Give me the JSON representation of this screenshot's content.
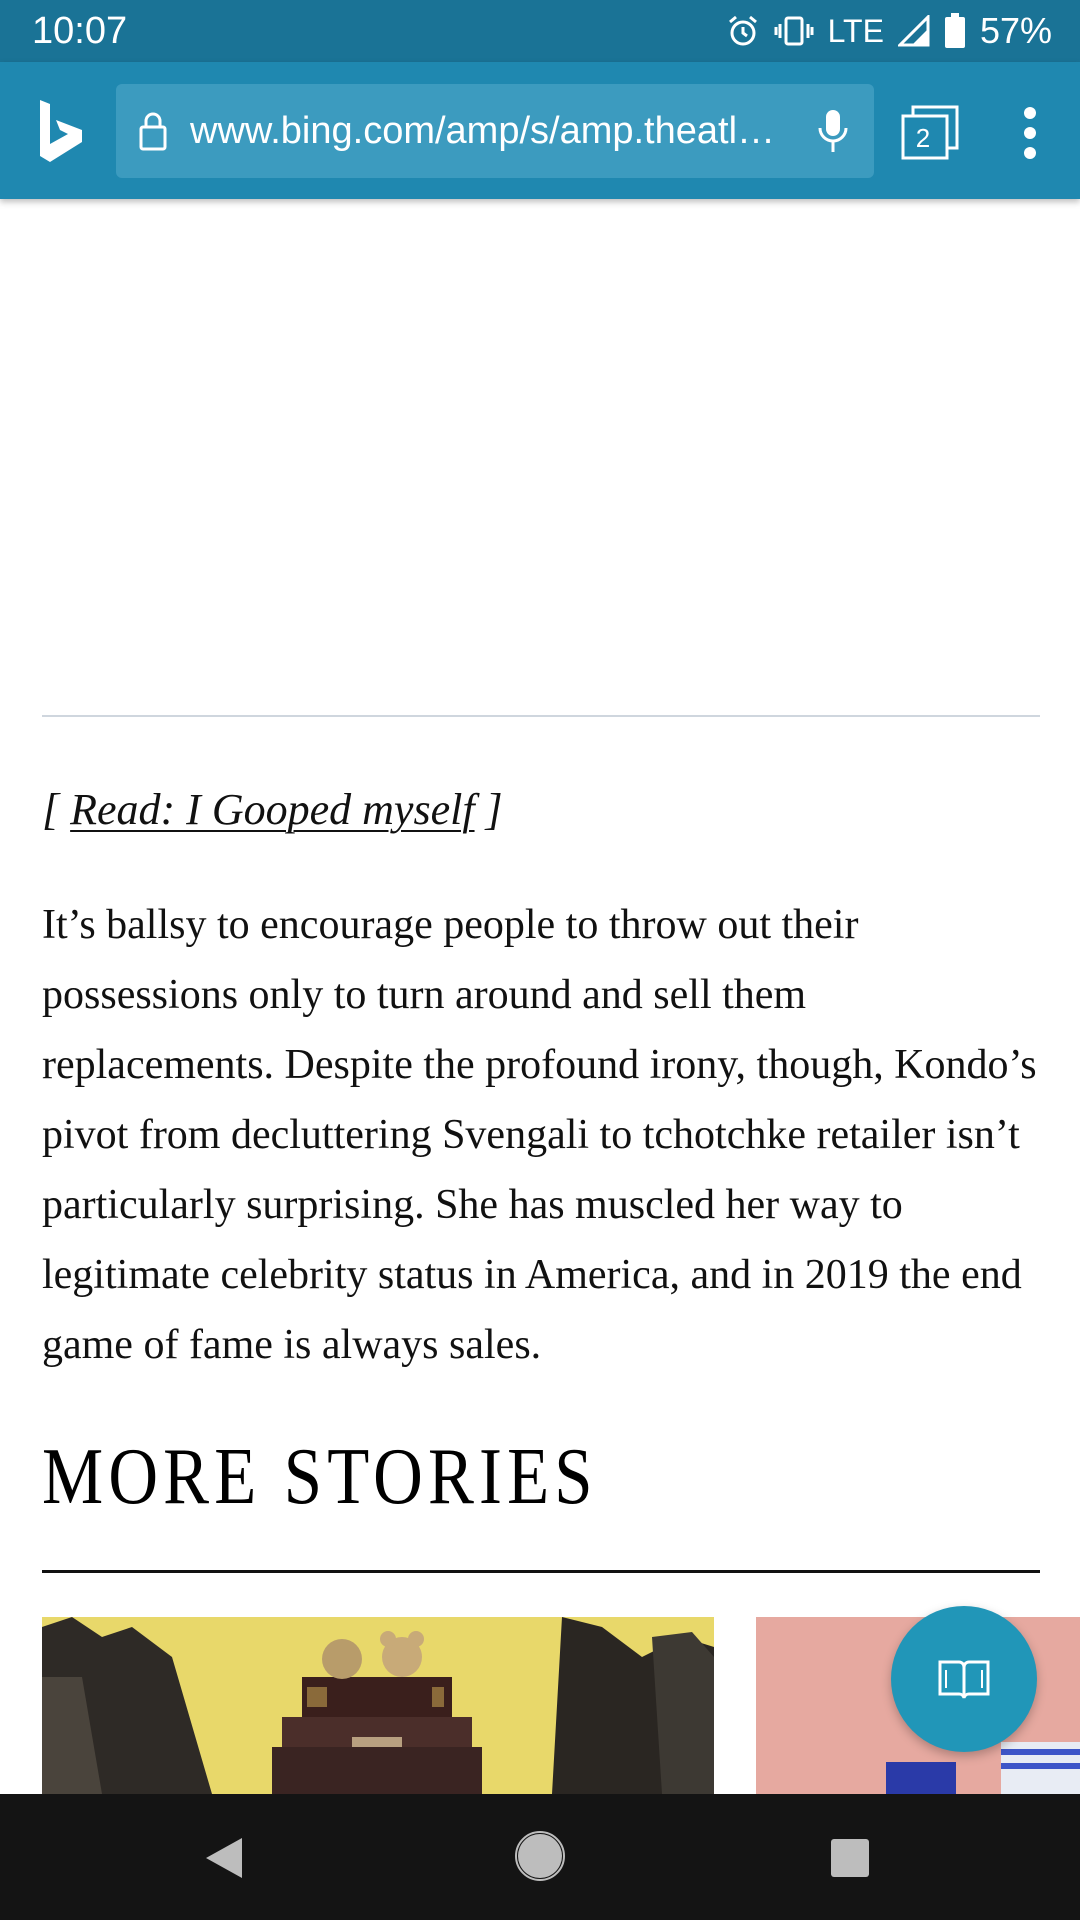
{
  "status_bar": {
    "time": "10:07",
    "network": "LTE",
    "battery": "57%"
  },
  "browser": {
    "url": "www.bing.com/amp/s/amp.theatl…",
    "tab_count": "2",
    "accent_color": "#1f88b0"
  },
  "article": {
    "read_prefix": "[ ",
    "read_link": "Read: I Gooped myself",
    "read_suffix": " ]",
    "body": "It’s ballsy to encourage people to throw out their possessions only to turn around and sell them replacements. Despite the profound irony, though, Kondo’s pivot from decluttering Svengali to tchotchke retailer isn’t particularly surprising. She has muscled her way to legitimate celebrity status in America, and in 2019 the end game of fame is always sales.",
    "more_stories_heading": "MORE STORIES"
  },
  "icons": {
    "status": [
      "alarm-icon",
      "vibrate-icon",
      "signal-icon",
      "battery-icon"
    ],
    "toolbar": [
      "bing-logo-icon",
      "lock-icon",
      "mic-icon",
      "tabs-icon",
      "more-menu-icon"
    ],
    "fab": "book-icon",
    "nav": [
      "back-icon",
      "home-icon",
      "recents-icon"
    ]
  }
}
